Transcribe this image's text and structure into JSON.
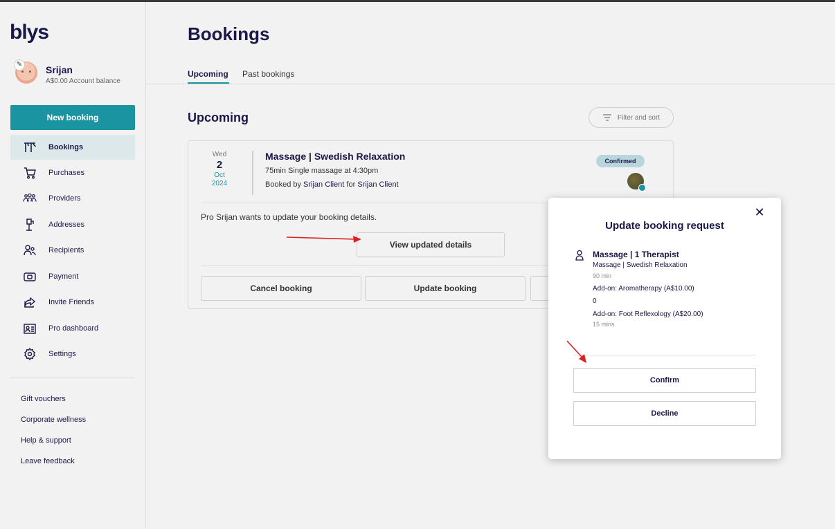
{
  "app": {
    "logo": "blys"
  },
  "user": {
    "name": "Srijan",
    "balance": "A$0.00 Account balance"
  },
  "sidebar": {
    "new_booking_label": "New booking",
    "items": [
      {
        "label": "Bookings",
        "icon": "bookings-icon",
        "active": true
      },
      {
        "label": "Purchases",
        "icon": "cart-icon"
      },
      {
        "label": "Providers",
        "icon": "providers-icon"
      },
      {
        "label": "Addresses",
        "icon": "address-icon"
      },
      {
        "label": "Recipients",
        "icon": "recipients-icon"
      },
      {
        "label": "Payment",
        "icon": "payment-icon"
      },
      {
        "label": "Invite Friends",
        "icon": "share-icon"
      },
      {
        "label": "Pro dashboard",
        "icon": "pro-dashboard-icon"
      },
      {
        "label": "Settings",
        "icon": "gear-icon"
      }
    ],
    "links": [
      "Gift vouchers",
      "Corporate wellness",
      "Help & support",
      "Leave feedback"
    ]
  },
  "page": {
    "title": "Bookings",
    "tabs": [
      "Upcoming",
      "Past bookings"
    ],
    "section_title": "Upcoming",
    "filter_label": "Filter and sort"
  },
  "booking": {
    "dow": "Wed",
    "day": "2",
    "month": "Oct",
    "year": "2024",
    "title": "Massage | Swedish Relaxation",
    "desc": "75min Single massage at 4:30pm",
    "booked_prefix": "Booked by ",
    "booked_by": "Srijan Client",
    "for_word": " for ",
    "booked_for": "Srijan Client",
    "status": "Confirmed",
    "update_message": "Pro Srijan wants to update your booking details.",
    "view_updated_label": "View updated details",
    "cancel_label": "Cancel booking",
    "update_label": "Update booking"
  },
  "modal": {
    "title": "Update booking request",
    "service": "Massage | 1 Therapist",
    "sub": "Massage | Swedish Relaxation",
    "duration": "90 min",
    "addon1": "Add-on: Aromatherapy (A$10.00)",
    "zero": "0",
    "addon2": "Add-on: Foot Reflexology (A$20.00)",
    "addon2_duration": "15 mins",
    "confirm_label": "Confirm",
    "decline_label": "Decline"
  },
  "colors": {
    "accent": "#1a94a0",
    "navy": "#1a1848",
    "annotation": "#e02020"
  }
}
